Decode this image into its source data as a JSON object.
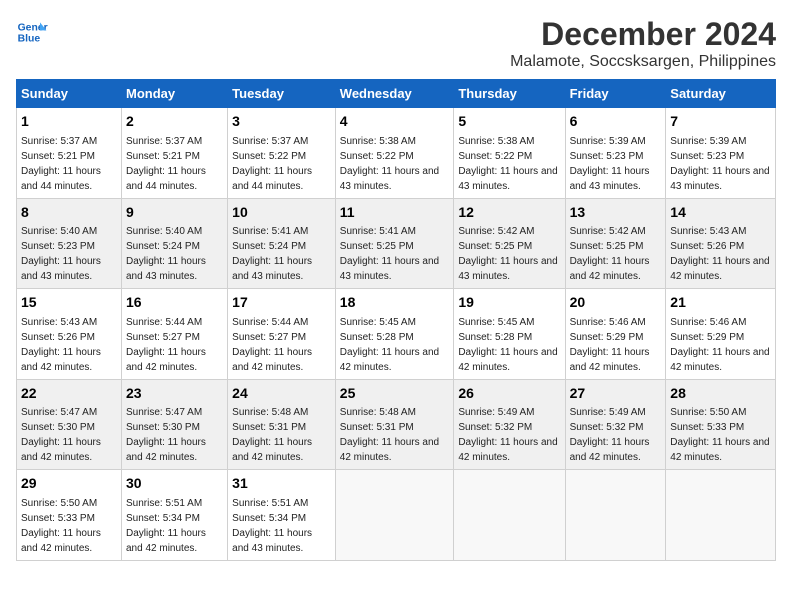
{
  "logo": {
    "line1": "General",
    "line2": "Blue"
  },
  "title": "December 2024",
  "subtitle": "Malamote, Soccsksargen, Philippines",
  "days_of_week": [
    "Sunday",
    "Monday",
    "Tuesday",
    "Wednesday",
    "Thursday",
    "Friday",
    "Saturday"
  ],
  "weeks": [
    [
      {
        "day": "1",
        "sunrise": "5:37 AM",
        "sunset": "5:21 PM",
        "daylight": "11 hours and 44 minutes."
      },
      {
        "day": "2",
        "sunrise": "5:37 AM",
        "sunset": "5:21 PM",
        "daylight": "11 hours and 44 minutes."
      },
      {
        "day": "3",
        "sunrise": "5:37 AM",
        "sunset": "5:22 PM",
        "daylight": "11 hours and 44 minutes."
      },
      {
        "day": "4",
        "sunrise": "5:38 AM",
        "sunset": "5:22 PM",
        "daylight": "11 hours and 43 minutes."
      },
      {
        "day": "5",
        "sunrise": "5:38 AM",
        "sunset": "5:22 PM",
        "daylight": "11 hours and 43 minutes."
      },
      {
        "day": "6",
        "sunrise": "5:39 AM",
        "sunset": "5:23 PM",
        "daylight": "11 hours and 43 minutes."
      },
      {
        "day": "7",
        "sunrise": "5:39 AM",
        "sunset": "5:23 PM",
        "daylight": "11 hours and 43 minutes."
      }
    ],
    [
      {
        "day": "8",
        "sunrise": "5:40 AM",
        "sunset": "5:23 PM",
        "daylight": "11 hours and 43 minutes."
      },
      {
        "day": "9",
        "sunrise": "5:40 AM",
        "sunset": "5:24 PM",
        "daylight": "11 hours and 43 minutes."
      },
      {
        "day": "10",
        "sunrise": "5:41 AM",
        "sunset": "5:24 PM",
        "daylight": "11 hours and 43 minutes."
      },
      {
        "day": "11",
        "sunrise": "5:41 AM",
        "sunset": "5:25 PM",
        "daylight": "11 hours and 43 minutes."
      },
      {
        "day": "12",
        "sunrise": "5:42 AM",
        "sunset": "5:25 PM",
        "daylight": "11 hours and 43 minutes."
      },
      {
        "day": "13",
        "sunrise": "5:42 AM",
        "sunset": "5:25 PM",
        "daylight": "11 hours and 42 minutes."
      },
      {
        "day": "14",
        "sunrise": "5:43 AM",
        "sunset": "5:26 PM",
        "daylight": "11 hours and 42 minutes."
      }
    ],
    [
      {
        "day": "15",
        "sunrise": "5:43 AM",
        "sunset": "5:26 PM",
        "daylight": "11 hours and 42 minutes."
      },
      {
        "day": "16",
        "sunrise": "5:44 AM",
        "sunset": "5:27 PM",
        "daylight": "11 hours and 42 minutes."
      },
      {
        "day": "17",
        "sunrise": "5:44 AM",
        "sunset": "5:27 PM",
        "daylight": "11 hours and 42 minutes."
      },
      {
        "day": "18",
        "sunrise": "5:45 AM",
        "sunset": "5:28 PM",
        "daylight": "11 hours and 42 minutes."
      },
      {
        "day": "19",
        "sunrise": "5:45 AM",
        "sunset": "5:28 PM",
        "daylight": "11 hours and 42 minutes."
      },
      {
        "day": "20",
        "sunrise": "5:46 AM",
        "sunset": "5:29 PM",
        "daylight": "11 hours and 42 minutes."
      },
      {
        "day": "21",
        "sunrise": "5:46 AM",
        "sunset": "5:29 PM",
        "daylight": "11 hours and 42 minutes."
      }
    ],
    [
      {
        "day": "22",
        "sunrise": "5:47 AM",
        "sunset": "5:30 PM",
        "daylight": "11 hours and 42 minutes."
      },
      {
        "day": "23",
        "sunrise": "5:47 AM",
        "sunset": "5:30 PM",
        "daylight": "11 hours and 42 minutes."
      },
      {
        "day": "24",
        "sunrise": "5:48 AM",
        "sunset": "5:31 PM",
        "daylight": "11 hours and 42 minutes."
      },
      {
        "day": "25",
        "sunrise": "5:48 AM",
        "sunset": "5:31 PM",
        "daylight": "11 hours and 42 minutes."
      },
      {
        "day": "26",
        "sunrise": "5:49 AM",
        "sunset": "5:32 PM",
        "daylight": "11 hours and 42 minutes."
      },
      {
        "day": "27",
        "sunrise": "5:49 AM",
        "sunset": "5:32 PM",
        "daylight": "11 hours and 42 minutes."
      },
      {
        "day": "28",
        "sunrise": "5:50 AM",
        "sunset": "5:33 PM",
        "daylight": "11 hours and 42 minutes."
      }
    ],
    [
      {
        "day": "29",
        "sunrise": "5:50 AM",
        "sunset": "5:33 PM",
        "daylight": "11 hours and 42 minutes."
      },
      {
        "day": "30",
        "sunrise": "5:51 AM",
        "sunset": "5:34 PM",
        "daylight": "11 hours and 42 minutes."
      },
      {
        "day": "31",
        "sunrise": "5:51 AM",
        "sunset": "5:34 PM",
        "daylight": "11 hours and 43 minutes."
      },
      null,
      null,
      null,
      null
    ]
  ],
  "labels": {
    "sunrise": "Sunrise:",
    "sunset": "Sunset:",
    "daylight": "Daylight:"
  }
}
